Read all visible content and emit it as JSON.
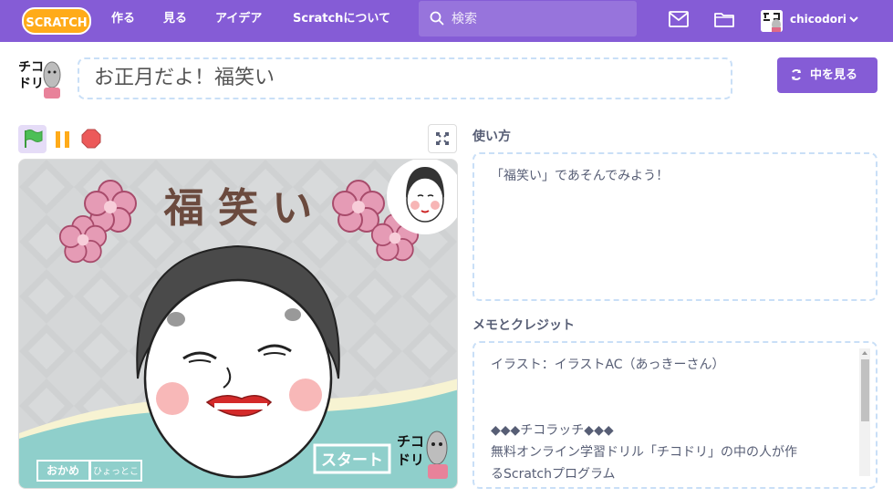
{
  "nav": {
    "logo_text": "SCRATCH",
    "links": [
      {
        "label": "作る"
      },
      {
        "label": "見る"
      },
      {
        "label": "アイデア"
      },
      {
        "label": "Scratchについて"
      }
    ],
    "search_placeholder": "検索",
    "username": "chicodori"
  },
  "project": {
    "title": "お正月だよ！福笑い",
    "see_inside_label": "中を見る",
    "avatar_text": "チコドリ"
  },
  "stage": {
    "heading": "福 笑 い",
    "start_label": "スタート",
    "tab_okame": "おかめ",
    "tab_hyottoko": "ひょっとこ",
    "logo_text": "チコドリ"
  },
  "instructions": {
    "heading": "使い方",
    "text": "「福笑い」であそんでみよう！"
  },
  "notes": {
    "heading": "メモとクレジット",
    "line1": "イラスト：イラストAC（あっきーさん）",
    "line2": "◆◆◆チコラッチ◆◆◆",
    "line3": "無料オンライン学習ドリル「チコドリ」の中の人が作",
    "line4": "るScratchプログラム"
  },
  "colors": {
    "brand": "#855cd6",
    "text": "#575e75",
    "border": "#c9dff7"
  }
}
